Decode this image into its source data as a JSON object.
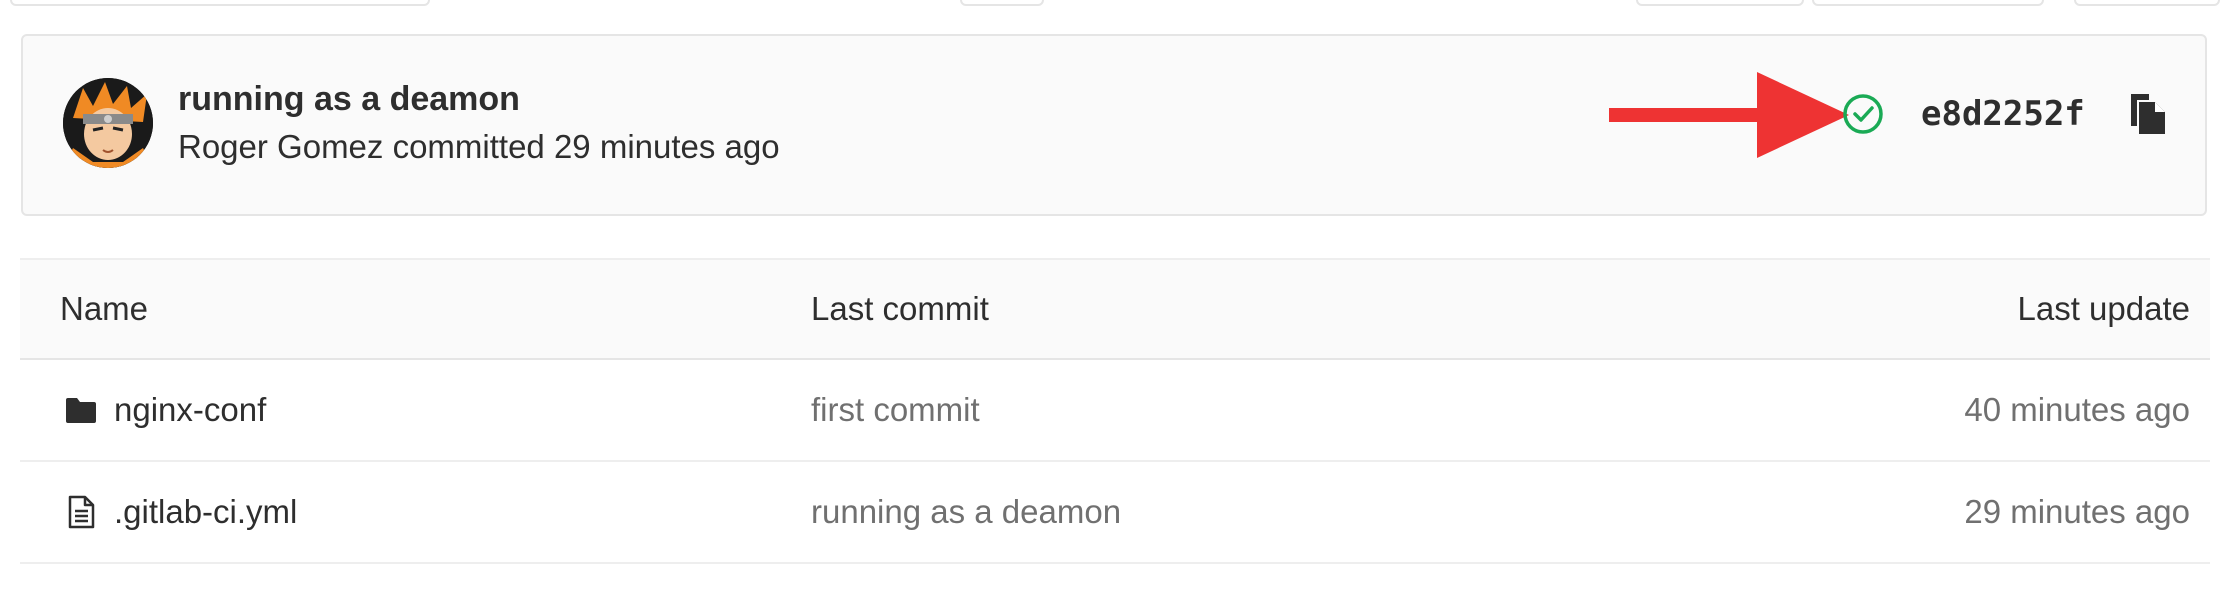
{
  "commit": {
    "title": "running as a deamon",
    "author": "Roger Gomez",
    "meta_text": "Roger Gomez committed 29 minutes ago",
    "sha": "e8d2252f",
    "pipeline_status": "passed",
    "status_color": "#1aaa55",
    "arrow_color": "#ee3333"
  },
  "table": {
    "headers": {
      "name": "Name",
      "last_commit": "Last commit",
      "last_update": "Last update"
    },
    "rows": [
      {
        "icon": "folder-icon",
        "name": "nginx-conf",
        "last_commit": "first commit",
        "last_update": "40 minutes ago"
      },
      {
        "icon": "file-text-icon",
        "name": ".gitlab-ci.yml",
        "last_commit": "running as a deamon",
        "last_update": "29 minutes ago"
      }
    ]
  }
}
